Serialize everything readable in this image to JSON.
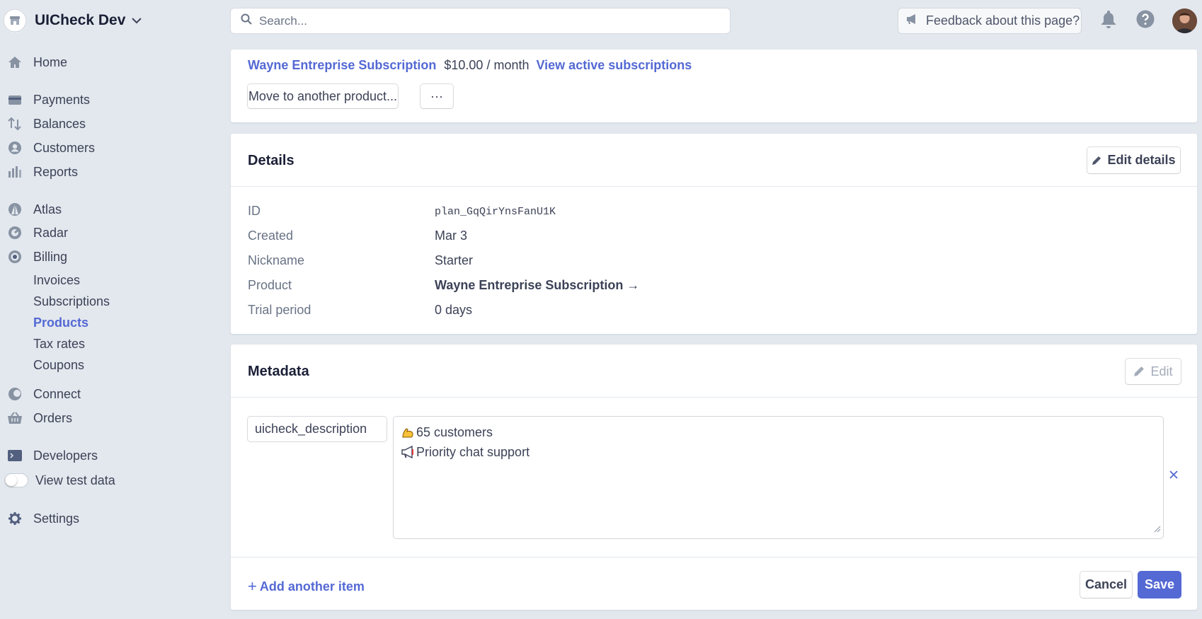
{
  "account": {
    "name": "UICheck Dev"
  },
  "sidebar": {
    "items": [
      {
        "label": "Home",
        "icon": "home-icon"
      },
      {
        "label": "Payments",
        "icon": "payments-icon"
      },
      {
        "label": "Balances",
        "icon": "balances-icon"
      },
      {
        "label": "Customers",
        "icon": "customers-icon"
      },
      {
        "label": "Reports",
        "icon": "reports-icon"
      },
      {
        "label": "Atlas",
        "icon": "atlas-icon"
      },
      {
        "label": "Radar",
        "icon": "radar-icon"
      },
      {
        "label": "Billing",
        "icon": "billing-icon"
      },
      {
        "label": "Connect",
        "icon": "connect-icon"
      },
      {
        "label": "Orders",
        "icon": "orders-icon"
      },
      {
        "label": "Developers",
        "icon": "developers-icon"
      },
      {
        "label": "View test data",
        "icon": "toggle"
      },
      {
        "label": "Settings",
        "icon": "gear-icon"
      }
    ],
    "billing_sub": [
      {
        "label": "Invoices"
      },
      {
        "label": "Subscriptions"
      },
      {
        "label": "Products",
        "active": true
      },
      {
        "label": "Tax rates"
      },
      {
        "label": "Coupons"
      }
    ],
    "test_data_enabled": false
  },
  "search": {
    "placeholder": "Search..."
  },
  "feedback": {
    "label": "Feedback about this page?"
  },
  "subscription": {
    "product": "Wayne Entreprise Subscription",
    "price": "$10.00 / month",
    "view_link": "View active subscriptions",
    "move_button": "Move to another product...",
    "more_button": "···"
  },
  "details": {
    "title": "Details",
    "edit_button": "Edit details",
    "rows": [
      {
        "label": "ID",
        "value": "plan_GqQirYnsFanU1K"
      },
      {
        "label": "Created",
        "value": "Mar 3"
      },
      {
        "label": "Nickname",
        "value": "Starter"
      },
      {
        "label": "Product",
        "value": "Wayne Entreprise Subscription →"
      },
      {
        "label": "Trial period",
        "value": "0 days"
      }
    ]
  },
  "metadata": {
    "title": "Metadata",
    "edit_button": "Edit",
    "key": "uicheck_description",
    "value_lines": [
      {
        "emoji": "flexed-biceps-icon",
        "text": "65 customers"
      },
      {
        "emoji": "megaphone-icon",
        "text": "Priority chat support"
      }
    ],
    "add_item": "Add another item",
    "cancel": "Cancel",
    "save": "Save"
  },
  "colors": {
    "accent": "#5469d4",
    "background": "#e3e8ee",
    "text": "#3c4257"
  }
}
